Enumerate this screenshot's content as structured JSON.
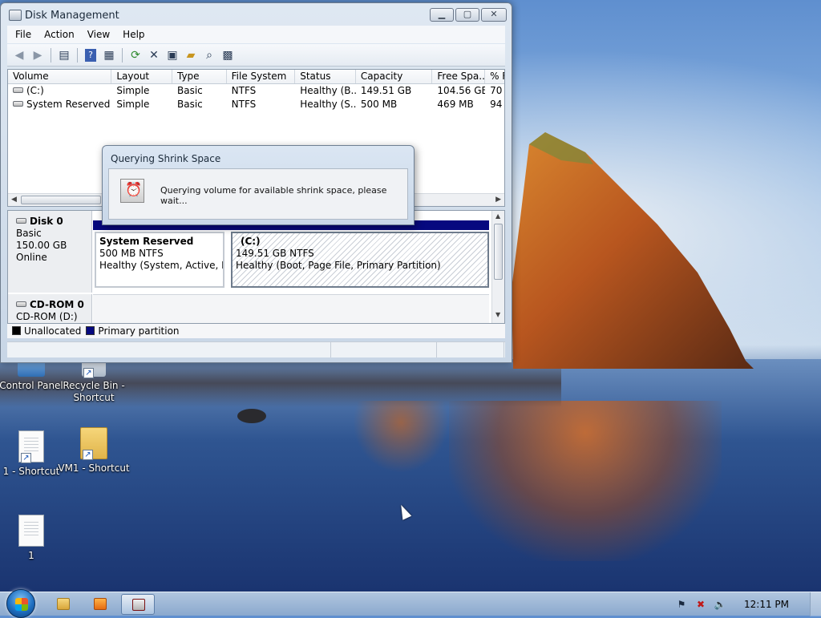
{
  "window": {
    "title": "Disk Management",
    "menu": [
      "File",
      "Action",
      "View",
      "Help"
    ]
  },
  "volume_list": {
    "columns": [
      "Volume",
      "Layout",
      "Type",
      "File System",
      "Status",
      "Capacity",
      "Free Spa...",
      "% F"
    ],
    "rows": [
      [
        "(C:)",
        "Simple",
        "Basic",
        "NTFS",
        "Healthy (B...",
        "149.51 GB",
        "104.56 GB",
        "70"
      ],
      [
        "System Reserved",
        "Simple",
        "Basic",
        "NTFS",
        "Healthy (S...",
        "500 MB",
        "469 MB",
        "94"
      ]
    ]
  },
  "disks": [
    {
      "name": "Disk 0",
      "type": "Basic",
      "size": "150.00 GB",
      "status": "Online",
      "partitions": [
        {
          "name": "System Reserved",
          "size": "500 MB NTFS",
          "status": "Healthy (System, Active, Prim"
        },
        {
          "name": "(C:)",
          "size": "149.51 GB NTFS",
          "status": "Healthy (Boot, Page File, Primary Partition)"
        }
      ]
    },
    {
      "name": "CD-ROM 0",
      "type": "CD-ROM (D:)"
    }
  ],
  "legend": {
    "unallocated": "Unallocated",
    "primary": "Primary partition",
    "unallocated_color": "#000000",
    "primary_color": "#06097f"
  },
  "dialog": {
    "title": "Querying Shrink Space",
    "message": "Querying volume for available shrink space, please wait..."
  },
  "desktop_icons": {
    "control_panel": "Control Panel",
    "recycle_bin": "Recycle Bin - Shortcut",
    "one_shortcut": "1 - Shortcut",
    "vm1_shortcut": "VM1 - Shortcut",
    "one": "1"
  },
  "taskbar": {
    "clock": "12:11 PM"
  }
}
